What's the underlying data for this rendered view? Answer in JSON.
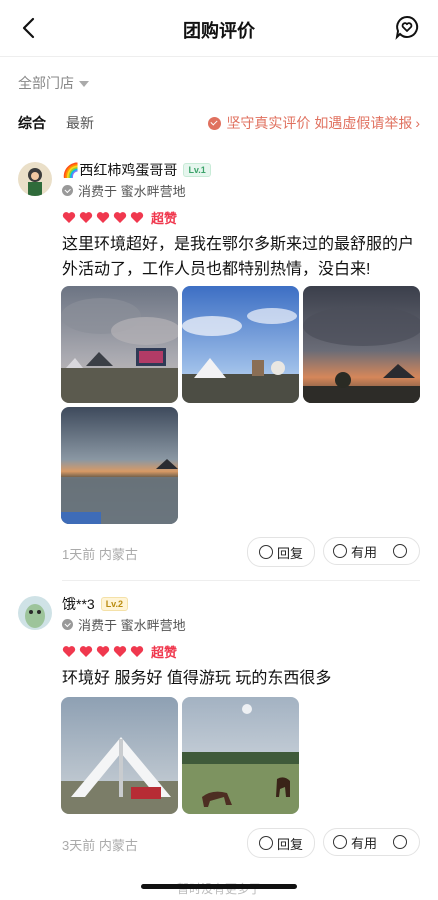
{
  "header": {
    "title": "团购评价",
    "back_icon": "chevron-left-icon",
    "message_icon": "chat-heart-icon"
  },
  "filter": {
    "store": "全部门店"
  },
  "tabs": [
    {
      "label": "综合",
      "active": true
    },
    {
      "label": "最新",
      "active": false
    }
  ],
  "notice": {
    "text": "坚守真实评价 如遇虚假请举报",
    "arrow": "›"
  },
  "reviews": [
    {
      "user": "🌈西红柿鸡蛋哥哥",
      "level": "Lv.1",
      "consumed": "消费于 蜜水畔营地",
      "hearts": 5,
      "rating_label": "超赞",
      "text": "这里环境超好，是我在鄂尔多斯来过的最舒服的户外活动了，工作人员也都特别热情，没白来!",
      "meta": "1天前 内蒙古",
      "reply": "回复",
      "useful": "有用"
    },
    {
      "user": "饿**3",
      "level": "Lv.2",
      "consumed": "消费于 蜜水畔营地",
      "hearts": 5,
      "rating_label": "超赞",
      "text": "环境好 服务好 值得游玩 玩的东西很多",
      "meta": "3天前 内蒙古",
      "reply": "回复",
      "useful": "有用"
    }
  ],
  "footer": {
    "text": "暂时没有更多了"
  },
  "colors": {
    "accent": "#f0384e",
    "notice": "#e0715f"
  }
}
